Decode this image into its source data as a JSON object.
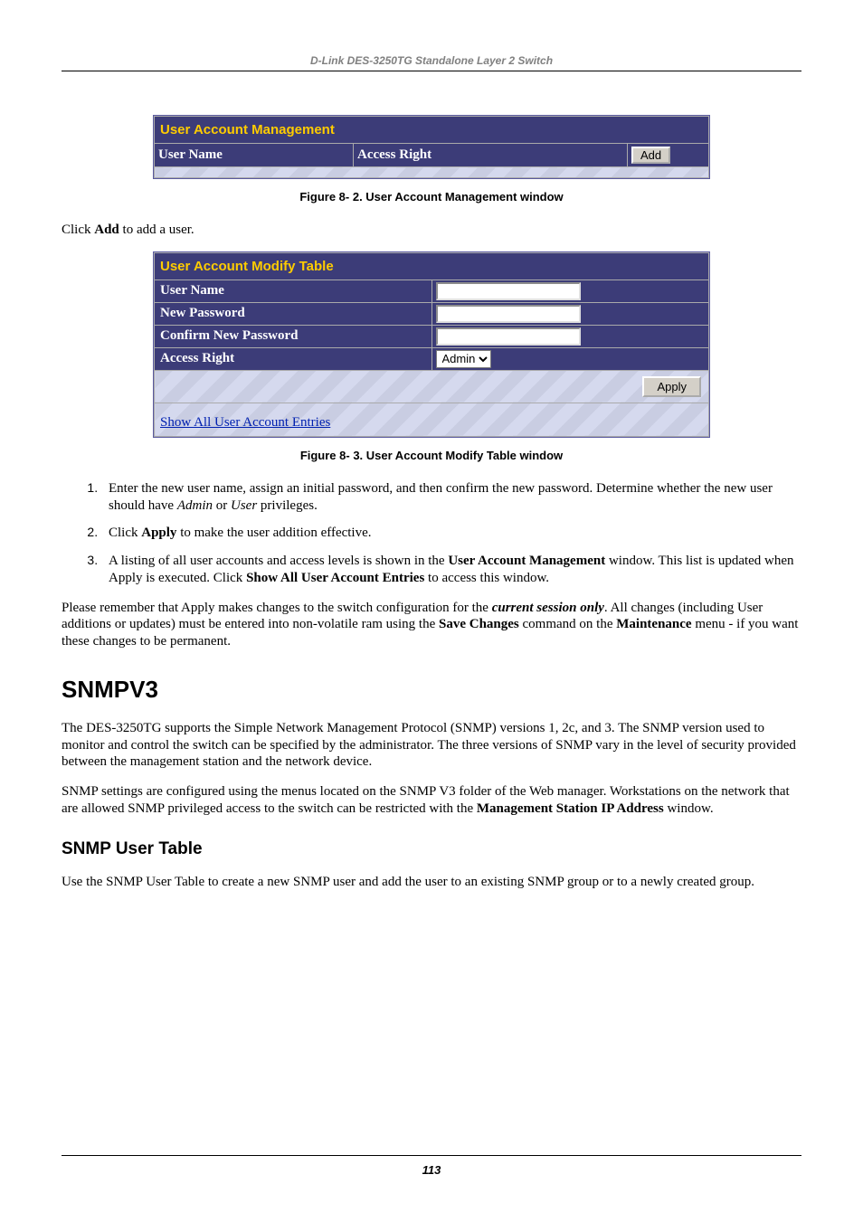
{
  "header": {
    "text": "D-Link DES-3250TG Standalone Layer 2 Switch"
  },
  "figure1": {
    "panel_title": "User Account Management",
    "col_user_name": "User Name",
    "col_access_right": "Access Right",
    "add_button": "Add",
    "caption": "Figure 8- 2.  User Account Management window"
  },
  "intro_line": {
    "pre": "Click ",
    "bold": "Add",
    "post": " to add a user."
  },
  "figure2": {
    "panel_title": "User Account Modify Table",
    "row_user_name": "User Name",
    "row_new_password": "New Password",
    "row_confirm": "Confirm New Password",
    "row_access_right": "Access Right",
    "access_right_value": "Admin",
    "apply_button": "Apply",
    "show_all_link": "Show All User Account Entries",
    "caption": "Figure 8- 3.  User Account Modify Table window"
  },
  "steps": {
    "s1_pre": "Enter the new user name, assign an initial password, and then confirm the new password. Determine whether the new user should have ",
    "s1_i1": "Admin",
    "s1_mid": " or ",
    "s1_i2": "User",
    "s1_post": " privileges.",
    "s2_pre": "Click ",
    "s2_b1": "Apply",
    "s2_post": " to make the user addition effective.",
    "s3_pre": "A listing of all user accounts and access levels is shown in the ",
    "s3_b1": "User Account Management",
    "s3_mid": " window. This list is updated when Apply is executed. Click ",
    "s3_b2": "Show All User Account Entries",
    "s3_post": " to access this window."
  },
  "para_remember": {
    "p1": "Please remember that Apply makes changes to the switch configuration for the ",
    "bi1": "current session only",
    "p2": ". All changes (including User additions or updates) must be entered into non-volatile ram using the ",
    "b1": "Save Changes",
    "p3": " command on the ",
    "b2": "Maintenance",
    "p4": " menu - if you want these changes to be permanent."
  },
  "snmp": {
    "heading": "SNMPV3",
    "para1": "The DES-3250TG supports the Simple Network Management Protocol (SNMP) versions 1, 2c, and 3. The SNMP version used to monitor and control the switch can be specified by the administrator. The three versions of SNMP vary in the level of security provided between the management station and the network device.",
    "para2_pre": "SNMP settings are configured using the menus located on the SNMP V3 folder of the Web manager. Workstations on the network that are allowed SNMP privileged access to the switch can be restricted with the ",
    "para2_b": "Management Station IP Address",
    "para2_post": " window.",
    "sub_heading": "SNMP User Table",
    "para3": "Use the SNMP User Table to create a new SNMP user and add the user to an existing SNMP group or to a newly created group."
  },
  "footer": {
    "page_number": "113"
  }
}
